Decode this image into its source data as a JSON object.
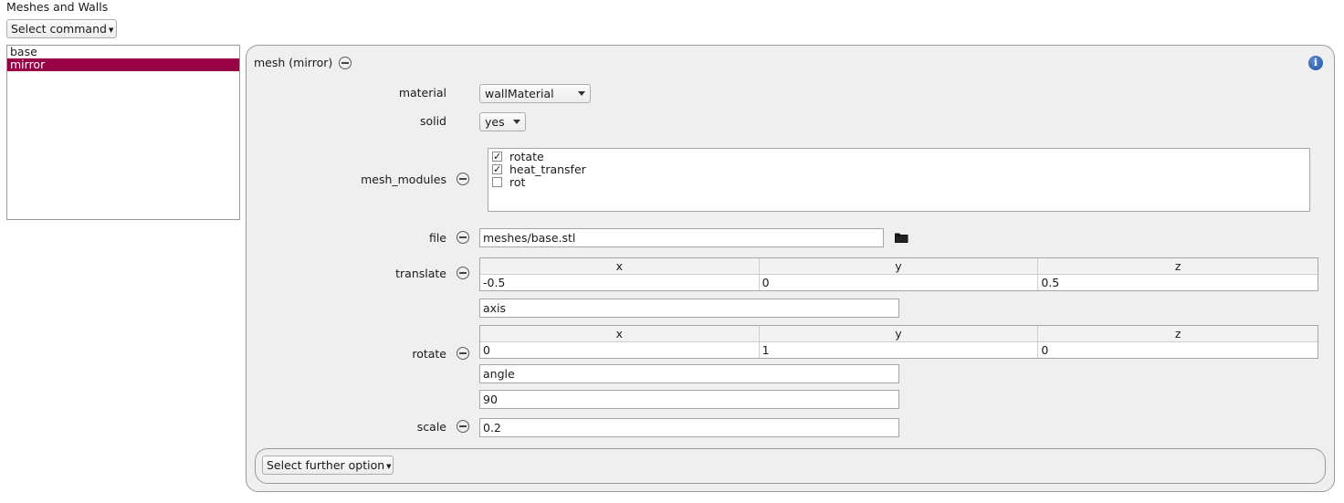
{
  "section": {
    "title": "Meshes and Walls"
  },
  "toolbar": {
    "select_command": "Select command"
  },
  "list": {
    "items": [
      "base",
      "mirror"
    ]
  },
  "panel": {
    "title": "mesh (mirror)",
    "material": {
      "label": "material",
      "value": "wallMaterial"
    },
    "solid": {
      "label": "solid",
      "value": "yes"
    },
    "mesh_modules": {
      "label": "mesh_modules",
      "items": [
        {
          "name": "rotate",
          "checked": true
        },
        {
          "name": "heat_transfer",
          "checked": true
        },
        {
          "name": "rot",
          "checked": false
        }
      ]
    },
    "file": {
      "label": "file",
      "value": "meshes/base.stl"
    },
    "translate": {
      "label": "translate",
      "headers": [
        "x",
        "y",
        "z"
      ],
      "values": [
        "-0.5",
        "0",
        "0.5"
      ]
    },
    "rotate": {
      "label": "rotate",
      "axis_label": "axis",
      "headers": [
        "x",
        "y",
        "z"
      ],
      "values": [
        "0",
        "1",
        "0"
      ],
      "angle_label": "angle",
      "angle_value": "90"
    },
    "scale": {
      "label": "scale",
      "value": "0.2"
    },
    "further": {
      "label": "Select further option"
    }
  },
  "icons": {
    "folder": "folder-icon",
    "info": "info-icon",
    "remove": "minus-circle-icon"
  },
  "colors": {
    "selection": "#990046",
    "info": "#1f4f9a"
  }
}
